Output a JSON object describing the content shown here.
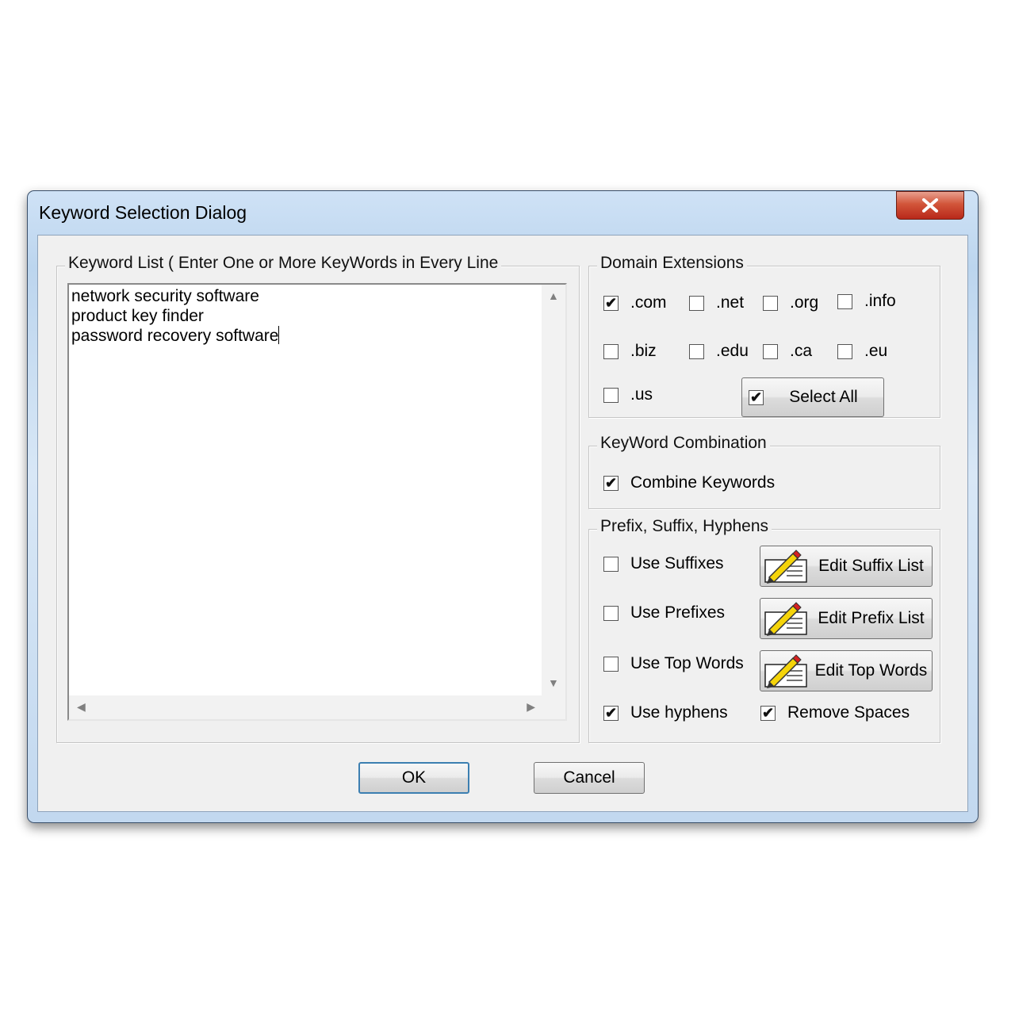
{
  "dialog": {
    "title": "Keyword Selection Dialog"
  },
  "keyword_list": {
    "legend": "Keyword List ( Enter One or More KeyWords in Every Line",
    "lines": [
      "network security software",
      "product key finder",
      "password recovery software"
    ]
  },
  "domain_extensions": {
    "legend": "Domain Extensions",
    "items": [
      {
        "label": ".com",
        "checked": true
      },
      {
        "label": ".net",
        "checked": false
      },
      {
        "label": ".org",
        "checked": false
      },
      {
        "label": ".info",
        "checked": false
      },
      {
        "label": ".biz",
        "checked": false
      },
      {
        "label": ".edu",
        "checked": false
      },
      {
        "label": ".ca",
        "checked": false
      },
      {
        "label": ".eu",
        "checked": false
      },
      {
        "label": ".us",
        "checked": false
      }
    ],
    "select_all": {
      "label": "Select All",
      "checked": true
    }
  },
  "combination": {
    "legend": "KeyWord Combination",
    "combine": {
      "label": "Combine Keywords",
      "checked": true
    }
  },
  "prefix_suffix": {
    "legend": "Prefix, Suffix, Hyphens",
    "use_suffixes": {
      "label": "Use Suffixes",
      "checked": false
    },
    "use_prefixes": {
      "label": "Use Prefixes",
      "checked": false
    },
    "use_top_words": {
      "label": "Use Top Words",
      "checked": false
    },
    "use_hyphens": {
      "label": "Use hyphens",
      "checked": true
    },
    "remove_spaces": {
      "label": "Remove Spaces",
      "checked": true
    },
    "edit_suffix": "Edit Suffix List",
    "edit_prefix": "Edit Prefix List",
    "edit_top": "Edit Top Words"
  },
  "buttons": {
    "ok": "OK",
    "cancel": "Cancel"
  },
  "check_mark": "✔",
  "colors": {
    "title_bar": "#c8dcf2",
    "close": "#c63b25",
    "panel": "#f0f0f0",
    "ok_border": "#3c7fb1"
  }
}
